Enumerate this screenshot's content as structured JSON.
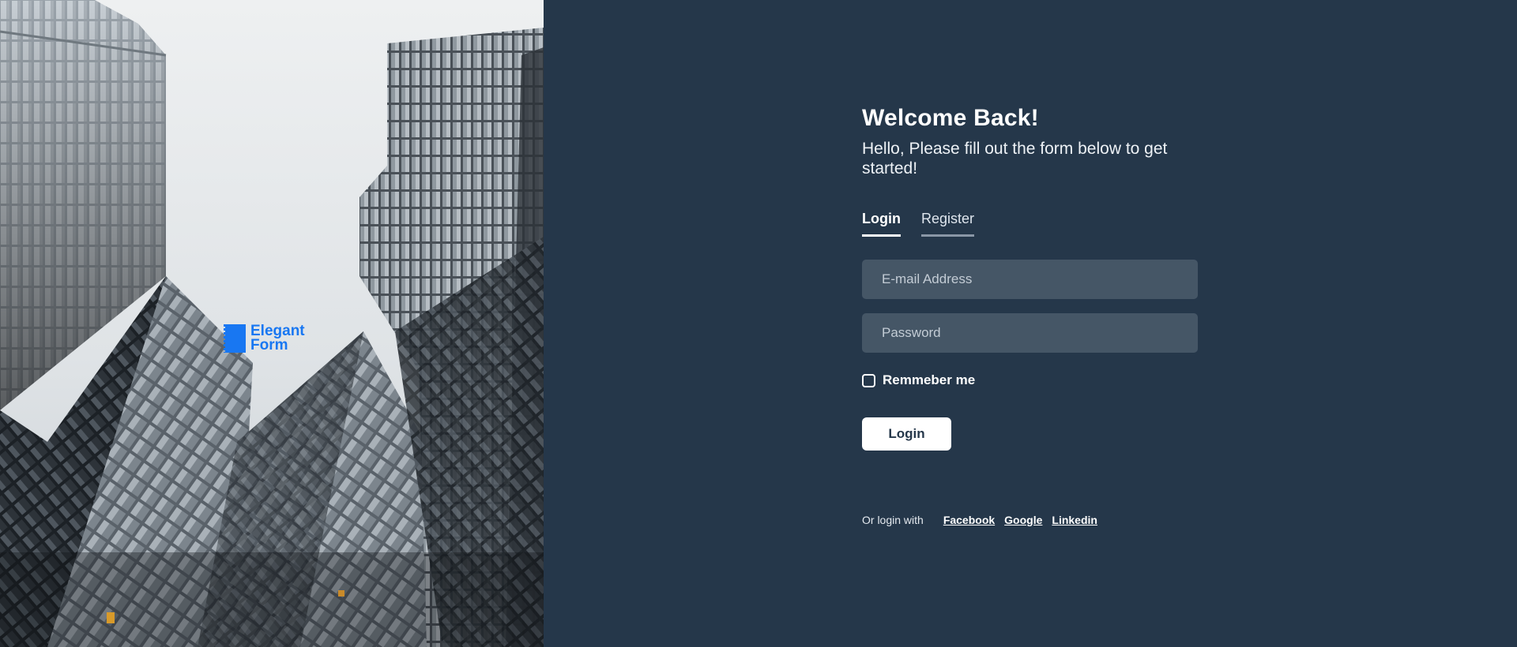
{
  "brand": {
    "line1": "Elegant",
    "line2": "Form",
    "color": "#1877f2"
  },
  "form": {
    "title": "Welcome Back!",
    "subtitle": "Hello, Please fill out the form below to get started!",
    "tabs": [
      {
        "label": "Login",
        "active": true
      },
      {
        "label": "Register",
        "active": false
      }
    ],
    "email_placeholder": "E-mail Address",
    "email_value": "",
    "password_placeholder": "Password",
    "password_value": "",
    "remember_label": "Remmeber me",
    "remember_checked": false,
    "submit_label": "Login",
    "social_label": "Or login with",
    "social_links": [
      "Facebook",
      "Google",
      "Linkedin"
    ]
  },
  "colors": {
    "panel_bg": "#25374a",
    "input_bg": "#455666",
    "button_bg": "#ffffff"
  }
}
